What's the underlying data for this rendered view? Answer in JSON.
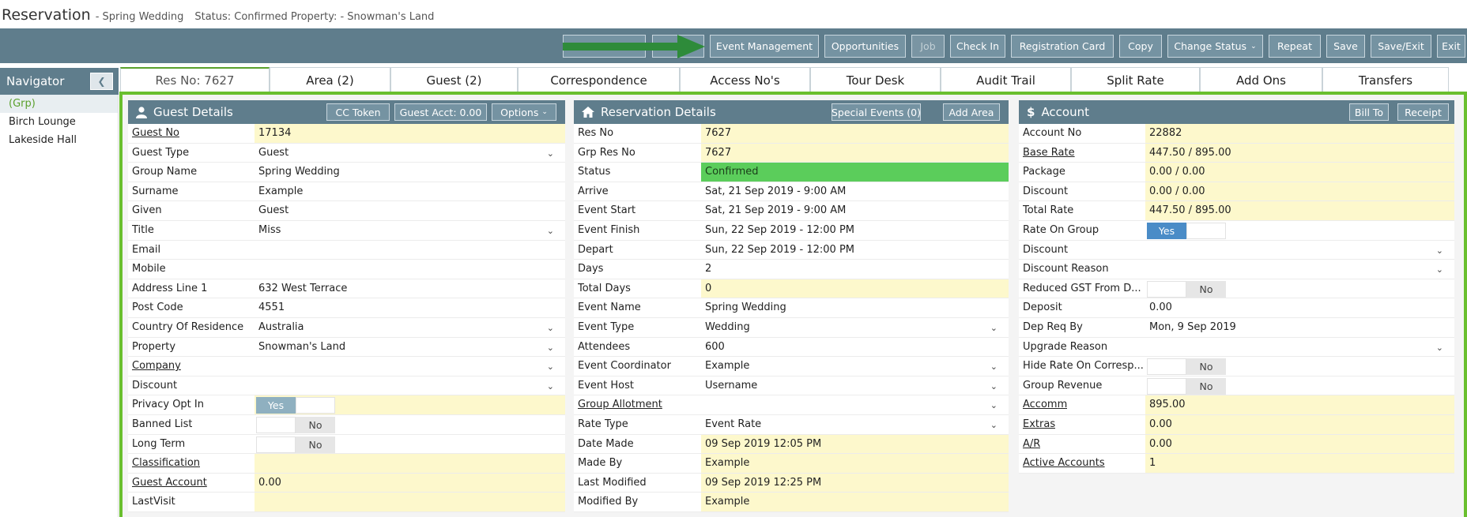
{
  "title": {
    "main": "Reservation",
    "sub": "- Spring Wedding",
    "status": "Status: Confirmed Property: - Snowman's Land"
  },
  "toolbar": {
    "buttons": [
      "",
      "",
      "Event Management",
      "Opportunities",
      "Job",
      "Check In",
      "Registration Card",
      "Copy",
      "Change Status",
      "Repeat",
      "Save",
      "Save/Exit",
      "Exit"
    ]
  },
  "navigator": {
    "title": "Navigator",
    "items": [
      "(Grp)",
      "Birch Lounge",
      "Lakeside Hall"
    ]
  },
  "tabs": [
    "Res No: 7627",
    "Area (2)",
    "Guest (2)",
    "Correspondence",
    "Access No's",
    "Tour Desk",
    "Audit Trail",
    "Split Rate",
    "Add Ons",
    "Transfers"
  ],
  "guest_details": {
    "title": "Guest Details",
    "buttons": [
      "CC Token",
      "Guest Acct: 0.00",
      "Options"
    ],
    "rows": [
      {
        "label": "Guest No",
        "value": "17134"
      },
      {
        "label": "Guest Type",
        "value": "Guest"
      },
      {
        "label": "Group Name",
        "value": "Spring Wedding"
      },
      {
        "label": "Surname",
        "value": "Example"
      },
      {
        "label": "Given",
        "value": "Guest"
      },
      {
        "label": "Title",
        "value": "Miss"
      },
      {
        "label": "Email",
        "value": ""
      },
      {
        "label": "Mobile",
        "value": ""
      },
      {
        "label": "Address Line 1",
        "value": "632 West Terrace"
      },
      {
        "label": "Post Code",
        "value": "4551"
      },
      {
        "label": "Country Of Residence",
        "value": "Australia"
      },
      {
        "label": "Property",
        "value": "Snowman's Land"
      },
      {
        "label": "Company",
        "value": ""
      },
      {
        "label": "Discount",
        "value": ""
      },
      {
        "label": "Privacy Opt In",
        "value": "Yes"
      },
      {
        "label": "Banned List",
        "value": "No"
      },
      {
        "label": "Long Term",
        "value": "No"
      },
      {
        "label": "Classification",
        "value": ""
      },
      {
        "label": "Guest Account",
        "value": "0.00"
      },
      {
        "label": "LastVisit",
        "value": ""
      }
    ]
  },
  "reservation_details": {
    "title": "Reservation Details",
    "buttons": [
      "Special Events (0)",
      "Add Area"
    ],
    "rows": [
      {
        "label": "Res No",
        "value": "7627"
      },
      {
        "label": "Grp Res No",
        "value": "7627"
      },
      {
        "label": "Status",
        "value": "Confirmed"
      },
      {
        "label": "Arrive",
        "value": "Sat, 21 Sep 2019 - 9:00 AM"
      },
      {
        "label": "Event Start",
        "value": "Sat, 21 Sep 2019 - 9:00 AM"
      },
      {
        "label": "Event Finish",
        "value": "Sun, 22 Sep 2019 - 12:00 PM"
      },
      {
        "label": "Depart",
        "value": "Sun, 22 Sep 2019 - 12:00 PM"
      },
      {
        "label": "Days",
        "value": "2"
      },
      {
        "label": "Total Days",
        "value": "0"
      },
      {
        "label": "Event Name",
        "value": "Spring Wedding"
      },
      {
        "label": "Event Type",
        "value": "Wedding"
      },
      {
        "label": "Attendees",
        "value": "600"
      },
      {
        "label": "Event Coordinator",
        "value": "Example"
      },
      {
        "label": "Event Host",
        "value": "Username"
      },
      {
        "label": "Group Allotment",
        "value": ""
      },
      {
        "label": "Rate Type",
        "value": "Event Rate"
      },
      {
        "label": "Date Made",
        "value": "09 Sep 2019 12:05 PM"
      },
      {
        "label": "Made By",
        "value": "Example"
      },
      {
        "label": "Last Modified",
        "value": "09 Sep 2019 12:25 PM"
      },
      {
        "label": "Modified By",
        "value": "Example"
      }
    ]
  },
  "account": {
    "title": "Account",
    "buttons": [
      "Bill To",
      "Receipt"
    ],
    "rows": [
      {
        "label": "Account No",
        "value": "22882"
      },
      {
        "label": "Base Rate",
        "value": "447.50 / 895.00"
      },
      {
        "label": "Package",
        "value": "0.00 / 0.00"
      },
      {
        "label": "Discount",
        "value": "0.00 / 0.00"
      },
      {
        "label": "Total Rate",
        "value": "447.50 / 895.00"
      },
      {
        "label": "Rate On Group",
        "value": "Yes"
      },
      {
        "label": "Discount",
        "value": ""
      },
      {
        "label": "Discount Reason",
        "value": ""
      },
      {
        "label": "Reduced GST From D...",
        "value": "No"
      },
      {
        "label": "Deposit",
        "value": "0.00"
      },
      {
        "label": "Dep Req By",
        "value": "Mon, 9 Sep 2019"
      },
      {
        "label": "Upgrade Reason",
        "value": ""
      },
      {
        "label": "Hide Rate On Corresp...",
        "value": "No"
      },
      {
        "label": "Group Revenue",
        "value": "No"
      },
      {
        "label": "Accomm",
        "value": "895.00"
      },
      {
        "label": "Extras",
        "value": "0.00"
      },
      {
        "label": "A/R",
        "value": "0.00"
      },
      {
        "label": "Active Accounts",
        "value": "1"
      }
    ]
  },
  "colors": {
    "toolbar": "#5f7d8c",
    "button": "#7593a2",
    "frame": "#6abf2e",
    "status_confirmed": "#5bcd5b",
    "highlight": "#fdf8cc",
    "toggle_yes_blue": "#4a8cc7",
    "toggle_yes_grey": "#8fb0c0",
    "arrow": "#2e8b3a"
  },
  "icons": {
    "guest_details": "user-icon",
    "reservation_details": "home-icon",
    "account": "dollar-icon",
    "navigator_toggle": "chevron-left-icon",
    "dropdown": "chevron-down-icon"
  }
}
